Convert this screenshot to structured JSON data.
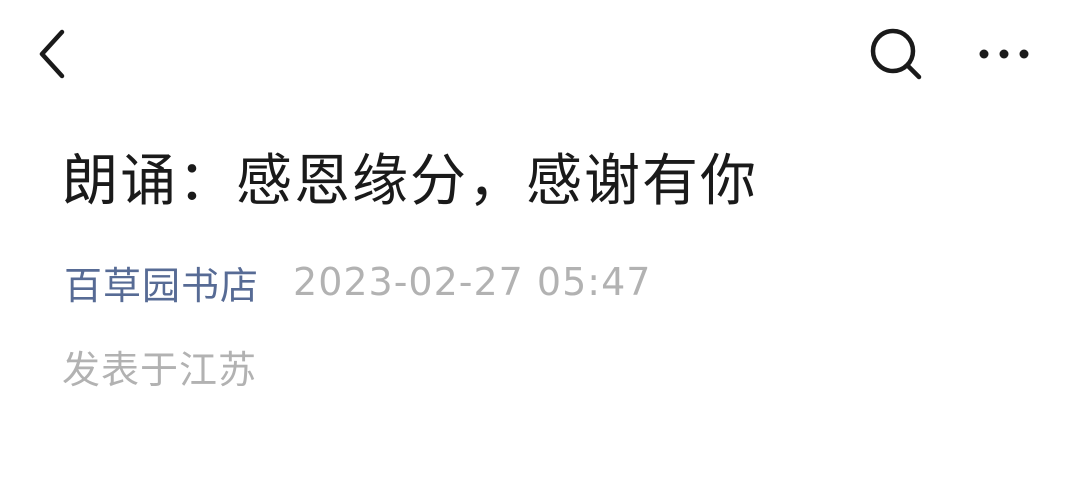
{
  "header": {
    "back_icon": "chevron-left-icon",
    "search_icon": "search-icon",
    "more_icon": "more-horizontal-icon"
  },
  "article": {
    "title": "朗诵：感恩缘分，感谢有你",
    "account_name": "百草园书店",
    "publish_time": "2023-02-27 05:47",
    "location": "发表于江苏"
  },
  "colors": {
    "title": "#1a1a1a",
    "account_link": "#576b95",
    "meta_gray": "#b2b2b2",
    "icon": "#1a1a1a",
    "background": "#ffffff"
  }
}
